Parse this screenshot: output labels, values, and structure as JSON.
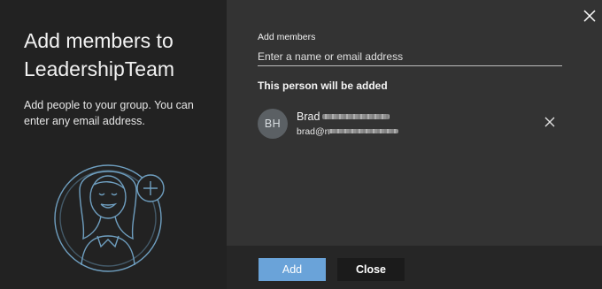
{
  "dialog": {
    "title": "Add members to LeadershipTeam",
    "description": "Add people to your group. You can enter any email address."
  },
  "form": {
    "label": "Add members",
    "placeholder": "Enter a name or email address"
  },
  "members_section": {
    "heading": "This person will be added",
    "members": [
      {
        "initials": "BH",
        "name": "Brad",
        "email": "brad@n"
      }
    ]
  },
  "footer": {
    "add_label": "Add",
    "close_label": "Close"
  },
  "colors": {
    "accent": "#6aa3d9",
    "illustration_stroke": "#6f9fc0",
    "left_pane": "#222222",
    "right_pane": "#333333"
  },
  "icons": {
    "dismiss": "close-icon",
    "remove_member": "remove-icon",
    "illustration": "person-add-illustration"
  }
}
